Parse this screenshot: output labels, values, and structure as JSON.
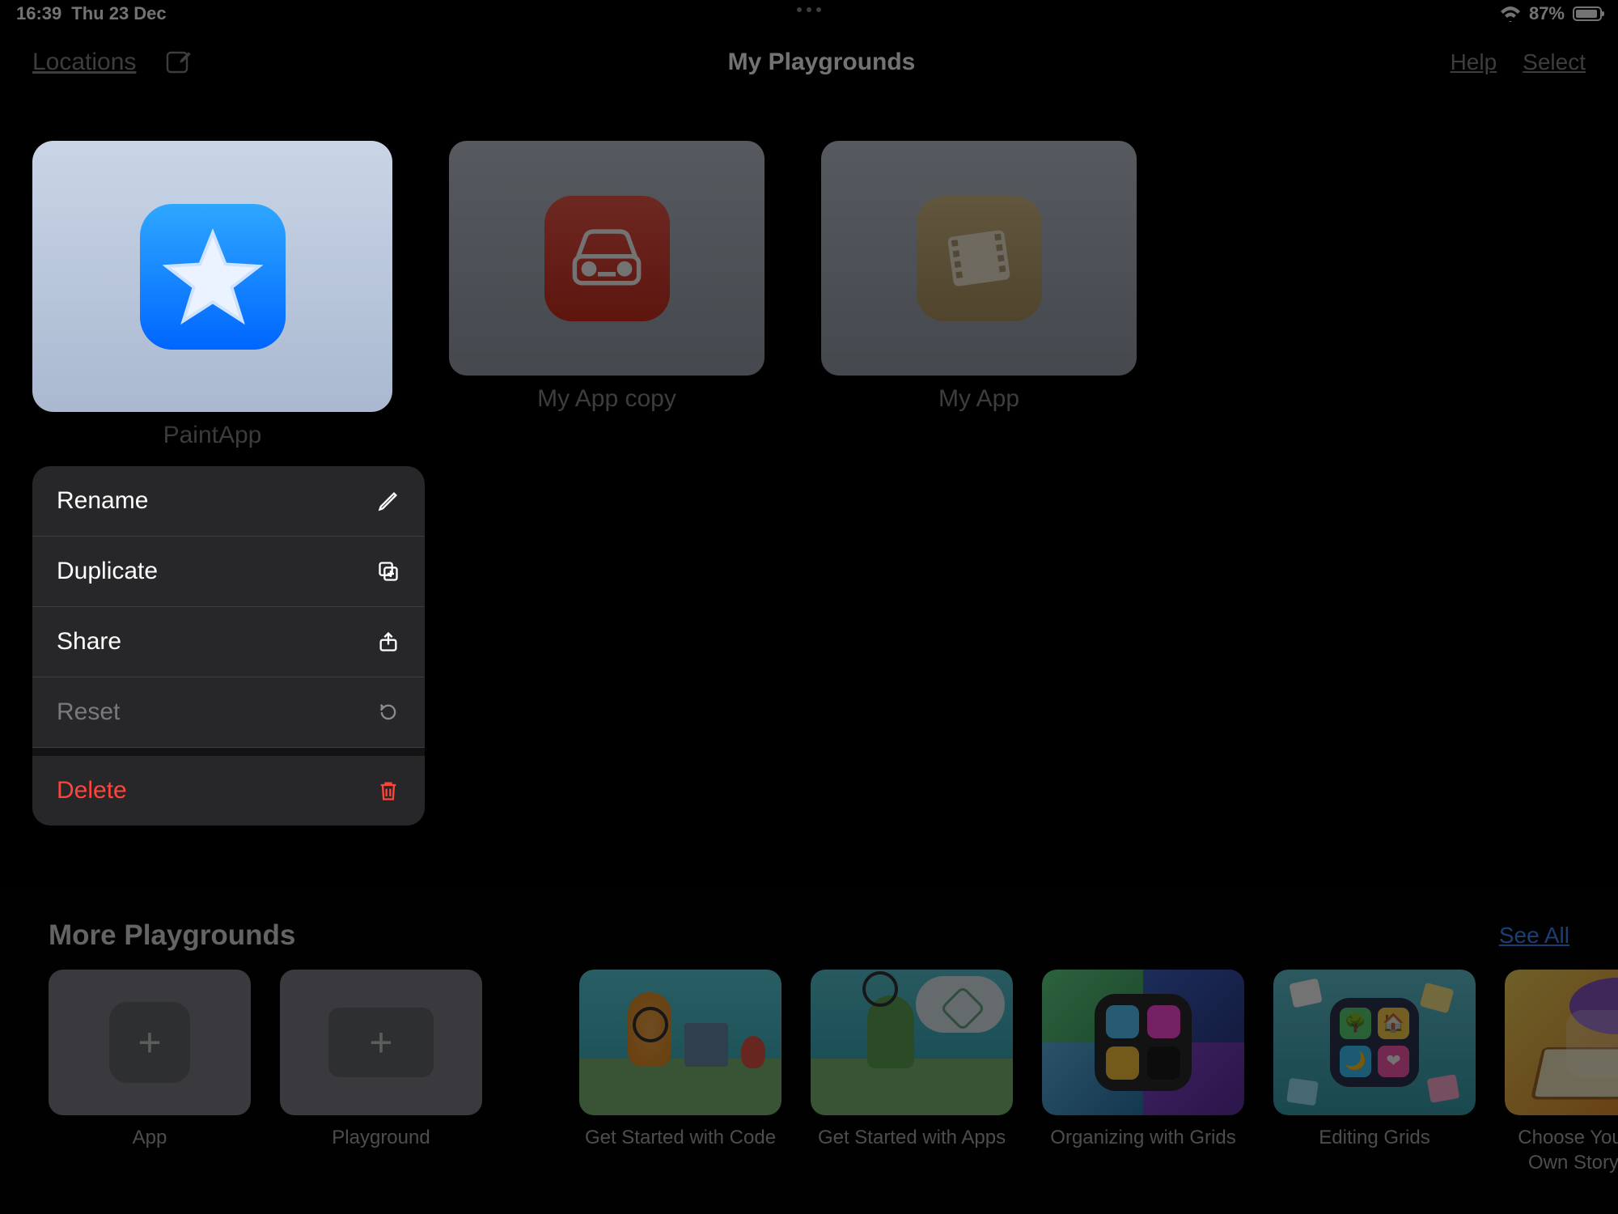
{
  "status": {
    "time": "16:39",
    "date": "Thu 23 Dec",
    "battery_pct": "87%"
  },
  "nav": {
    "locations": "Locations",
    "title": "My Playgrounds",
    "help": "Help",
    "select": "Select"
  },
  "playgrounds": [
    {
      "name": "PaintApp",
      "icon": "star",
      "accent": "#1e90ff",
      "highlighted": true
    },
    {
      "name": "My App copy",
      "icon": "car",
      "accent": "#d83c2b",
      "highlighted": false
    },
    {
      "name": "My App",
      "icon": "film",
      "accent": "#c9a96b",
      "highlighted": false
    }
  ],
  "context_menu": [
    {
      "label": "Rename",
      "icon": "pencil",
      "state": "normal"
    },
    {
      "label": "Duplicate",
      "icon": "duplicate",
      "state": "normal"
    },
    {
      "label": "Share",
      "icon": "share",
      "state": "normal"
    },
    {
      "label": "Reset",
      "icon": "reset",
      "state": "disabled"
    },
    {
      "label": "Delete",
      "icon": "trash",
      "state": "danger"
    }
  ],
  "more": {
    "title": "More Playgrounds",
    "see_all": "See All",
    "items": [
      {
        "name": "App",
        "kind": "new-app"
      },
      {
        "name": "Playground",
        "kind": "new-playground"
      },
      {
        "name": "Get Started with Code",
        "kind": "scene-byte"
      },
      {
        "name": "Get Started with Apps",
        "kind": "scene-hopper"
      },
      {
        "name": "Organizing with Grids",
        "kind": "scene-grid"
      },
      {
        "name": "Editing Grids",
        "kind": "scene-editing"
      },
      {
        "name": "Choose Your Own Story",
        "kind": "scene-story"
      }
    ]
  }
}
